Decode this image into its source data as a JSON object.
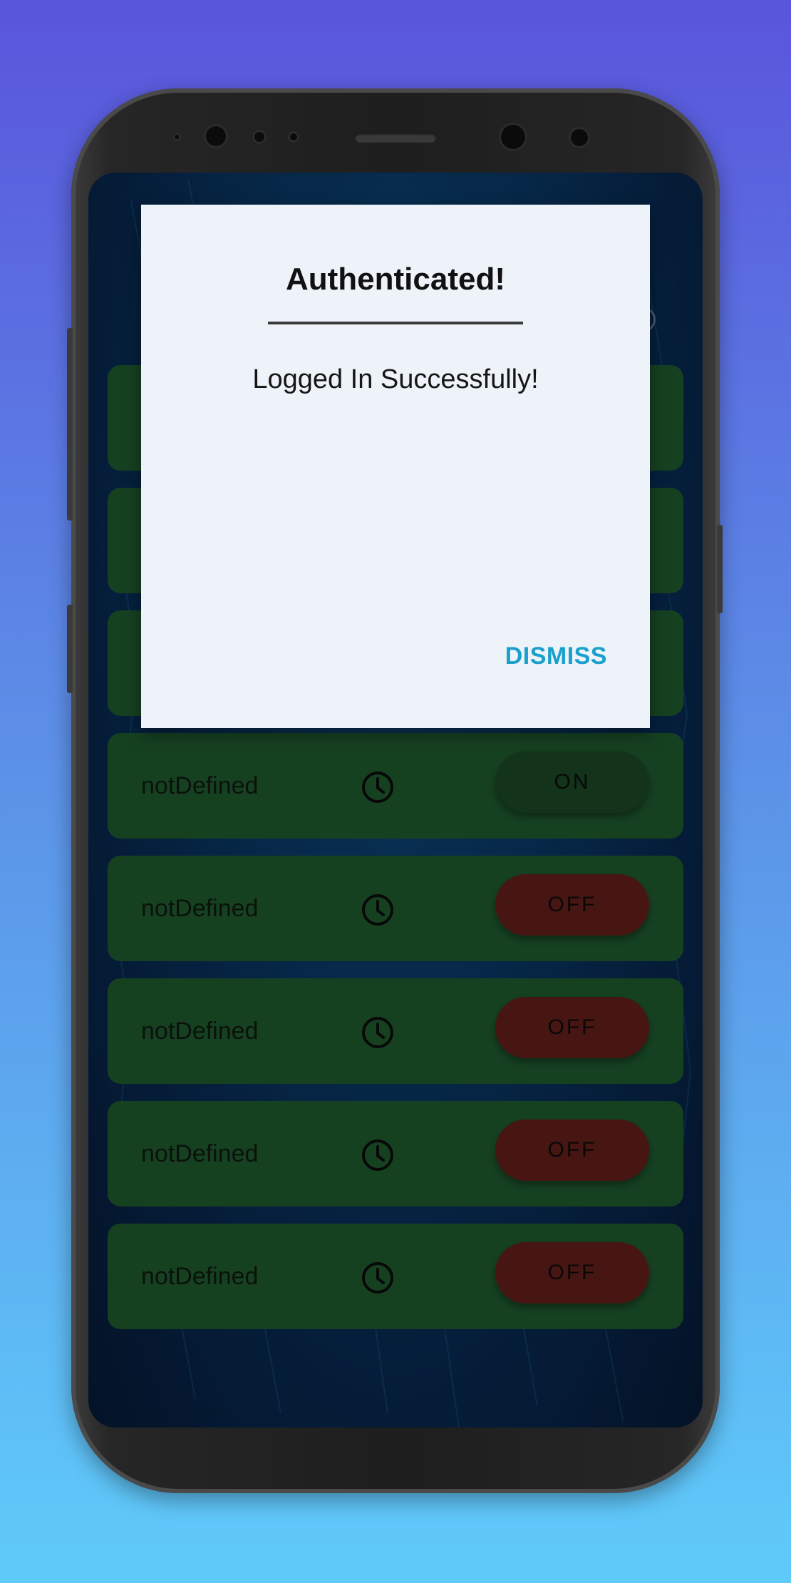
{
  "dialog": {
    "title": "Authenticated!",
    "message": "Logged In Successfully!",
    "dismiss_label": "DISMISS"
  },
  "rows": [
    {
      "label": "notDefined",
      "icon": "clock-icon",
      "state": "ON"
    },
    {
      "label": "notDefined",
      "icon": "clock-icon",
      "state": "OFF"
    },
    {
      "label": "notDefined",
      "icon": "clock-icon",
      "state": "OFF"
    },
    {
      "label": "notDefined",
      "icon": "clock-icon",
      "state": "OFF"
    },
    {
      "label": "notDefined",
      "icon": "clock-icon",
      "state": "OFF"
    }
  ],
  "colors": {
    "accent": "#1aa0cc",
    "row_bg": "#1f5a2f",
    "on": "#1b4725",
    "off": "#641f1a"
  }
}
